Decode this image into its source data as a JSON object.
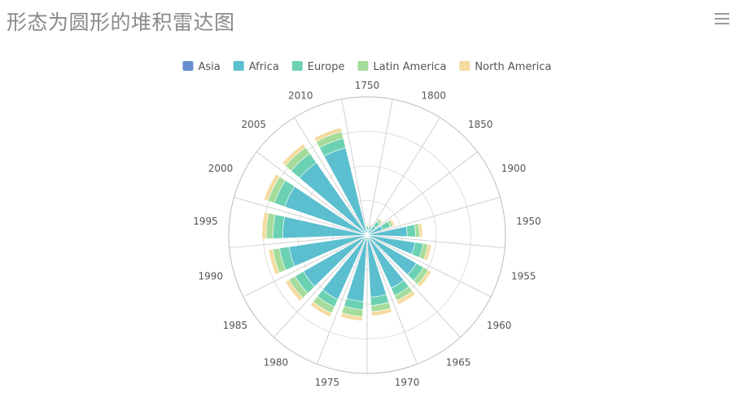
{
  "page": {
    "title": "形态为圆形的堆积雷达图"
  },
  "toolbox": {
    "menu_icon": "hamburger-menu-icon"
  },
  "chart_data": {
    "type": "bar",
    "coordinate_system": "polar",
    "stacked": true,
    "categories": [
      "1750",
      "1800",
      "1850",
      "1900",
      "1950",
      "1955",
      "1960",
      "1965",
      "1970",
      "1975",
      "1980",
      "1985",
      "1990",
      "1995",
      "2000",
      "2005",
      "2010"
    ],
    "radius_max": 1000,
    "legend": {
      "position": "top-center",
      "entries": [
        "Asia",
        "Africa",
        "Europe",
        "Latin America",
        "North America"
      ]
    },
    "series": [
      {
        "name": "Asia",
        "color": "#6a8fd0",
        "values": [
          20,
          12,
          10,
          8,
          10,
          10,
          10,
          10,
          10,
          10,
          10,
          10,
          10,
          10,
          10,
          10,
          10
        ]
      },
      {
        "name": "Africa",
        "color": "#5bbfcf",
        "values": [
          20,
          30,
          70,
          110,
          280,
          340,
          400,
          410,
          440,
          470,
          500,
          520,
          560,
          600,
          620,
          630,
          640
        ]
      },
      {
        "name": "Europe",
        "color": "#6cd1b2",
        "values": [
          20,
          20,
          40,
          60,
          60,
          60,
          60,
          60,
          60,
          60,
          60,
          70,
          70,
          70,
          80,
          80,
          70
        ]
      },
      {
        "name": "Latin America",
        "color": "#a5dc9b",
        "values": [
          10,
          10,
          20,
          20,
          30,
          35,
          40,
          40,
          45,
          50,
          50,
          50,
          50,
          50,
          50,
          55,
          50
        ]
      },
      {
        "name": "North America",
        "color": "#f4dba0",
        "values": [
          5,
          8,
          10,
          15,
          20,
          25,
          25,
          30,
          30,
          30,
          30,
          30,
          30,
          30,
          30,
          30,
          30
        ]
      }
    ],
    "grid": true
  }
}
